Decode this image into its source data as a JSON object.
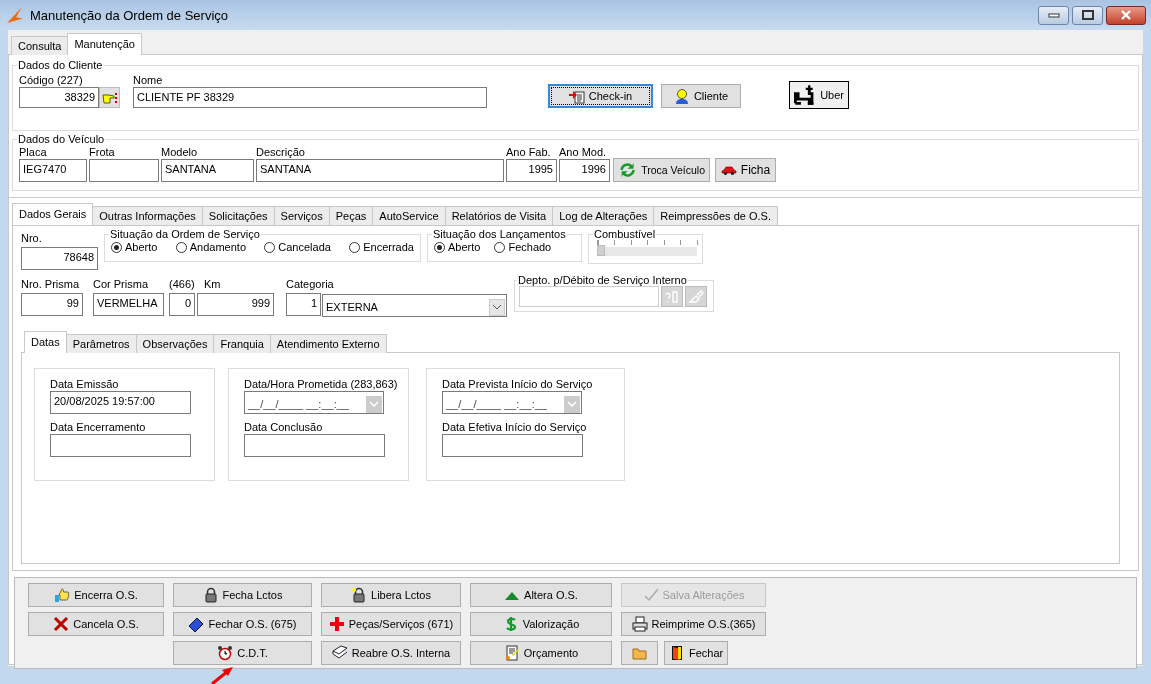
{
  "window": {
    "title": "Manutenção da Ordem de Serviço"
  },
  "main_tabs": [
    {
      "label": "Consulta",
      "selected": false
    },
    {
      "label": "Manutenção",
      "selected": true
    }
  ],
  "cliente": {
    "title": "Dados do Cliente",
    "code_label": "Código (227)",
    "code": "38329",
    "name_label": "Nome",
    "name": "CLIENTE PF 38329",
    "buttons": [
      {
        "label": "Check-in",
        "kind": "checkin",
        "focused": true
      },
      {
        "label": "Cliente",
        "kind": "person",
        "focused": false
      },
      {
        "label": "Uber",
        "kind": "uber",
        "focused": false
      }
    ]
  },
  "veiculo": {
    "title": "Dados do Veículo",
    "fields": [
      {
        "label": "Placa",
        "value": "IEG7470"
      },
      {
        "label": "Frota"
      },
      {
        "label": "Modelo",
        "value": "SANTANA"
      },
      {
        "label": "Descrição",
        "value": "SANTANA"
      },
      {
        "label": "Ano Fab.",
        "value": "1995"
      },
      {
        "label": "Ano Mod.",
        "value": "1996"
      }
    ],
    "buttons": [
      {
        "label": "Troca Veículo",
        "kind": "refresh"
      },
      {
        "label": "Ficha",
        "kind": "car"
      }
    ]
  },
  "tabs": [
    {
      "label": "Dados Gerais",
      "selected": true
    },
    {
      "label": "Outras Informações",
      "selected": false
    },
    {
      "label": "Solicitações",
      "selected": false
    },
    {
      "label": "Serviços",
      "selected": false
    },
    {
      "label": "Peças",
      "selected": false
    },
    {
      "label": "AutoService",
      "selected": false
    },
    {
      "label": "Relatórios de Visita",
      "selected": false
    },
    {
      "label": "Log de Alterações",
      "selected": false
    },
    {
      "label": "Reimpressões de O.S.",
      "selected": false
    }
  ],
  "dados_gerais": {
    "nro": {
      "label": "Nro.",
      "value": "78648"
    },
    "situacao_os": {
      "title": "Situação da Ordem de Serviço",
      "options": [
        {
          "label": "Aberto",
          "selected": true
        },
        {
          "label": "Andamento",
          "selected": false
        },
        {
          "label": "Cancelada",
          "selected": false
        },
        {
          "label": "Encerrada",
          "selected": false
        }
      ]
    },
    "situacao_lancamentos": {
      "title": "Situação dos Lançamentos",
      "options": [
        {
          "label": "Aberto",
          "selected": true
        },
        {
          "label": "Fechado",
          "selected": false
        }
      ]
    },
    "combustivel": {
      "title": "Combustível",
      "level": 0
    },
    "fields": [
      {
        "label": "Nro. Prisma",
        "value": "99"
      },
      {
        "label": "Cor Prisma",
        "value": "VERMELHA"
      },
      {
        "label": "(466)",
        "value": "0"
      },
      {
        "label": "Km",
        "value": "999"
      },
      {
        "label": "Categoria",
        "value": "1"
      }
    ],
    "categoria": "EXTERNA",
    "depto": {
      "title": "Depto. p/Débito de Serviço Interno"
    }
  },
  "sub_tabs": [
    {
      "label": "Datas",
      "selected": true
    },
    {
      "label": "Parâmetros",
      "selected": false
    },
    {
      "label": "Observações",
      "selected": false
    },
    {
      "label": "Franquia",
      "selected": false
    },
    {
      "label": "Atendimento Externo",
      "selected": false
    }
  ],
  "datas": [
    {
      "fields": [
        {
          "label": "Data Emissão",
          "kind": "text",
          "value": "20/08/2025 19:57:00"
        },
        {
          "label": "Data Encerramento",
          "kind": "text"
        }
      ]
    },
    {
      "fields": [
        {
          "label": "Data/Hora Prometida (283,863)",
          "kind": "datetime",
          "value": "__/__/____ __:__:__"
        },
        {
          "label": "Data Conclusão",
          "kind": "text"
        }
      ]
    },
    {
      "fields": [
        {
          "label": "Data Prevista Início do Serviço",
          "kind": "datetime",
          "value": "__/__/____ __:__:__"
        },
        {
          "label": "Data Efetiva Início do Serviço",
          "kind": "text"
        }
      ]
    }
  ],
  "actions": [
    [
      {
        "label": "Encerra O.S.",
        "kind": "thumb",
        "disabled": false
      },
      {
        "label": "Fecha Lctos",
        "kind": "lock",
        "disabled": false
      },
      {
        "label": "Libera Lctos",
        "kind": "unlock",
        "disabled": false
      },
      {
        "label": "Altera O.S.",
        "kind": "up",
        "disabled": false
      },
      {
        "label": "Salva Alterações",
        "kind": "check",
        "disabled": true
      }
    ],
    [
      {
        "label": "Cancela O.S.",
        "kind": "x",
        "disabled": false
      },
      {
        "label": "Fechar O.S. (675)",
        "kind": "bluebook",
        "disabled": false
      },
      {
        "label": "Peças/Serviços (671)",
        "kind": "cross",
        "disabled": false
      },
      {
        "label": "Valorização",
        "kind": "dollar",
        "disabled": false
      },
      {
        "label": "Reimprime O.S.(365)",
        "kind": "printer",
        "disabled": false
      }
    ],
    [
      {
        "label": "C.D.T.",
        "kind": "alarm",
        "disabled": false
      },
      {
        "label": "Reabre O.S. Interna",
        "kind": "openbook",
        "disabled": false
      },
      {
        "label": "Orçamento",
        "kind": "doc",
        "disabled": false
      },
      {
        "kind": "folder",
        "disabled": false
      },
      {
        "label": "Fechar",
        "kind": "door",
        "disabled": false
      }
    ]
  ]
}
